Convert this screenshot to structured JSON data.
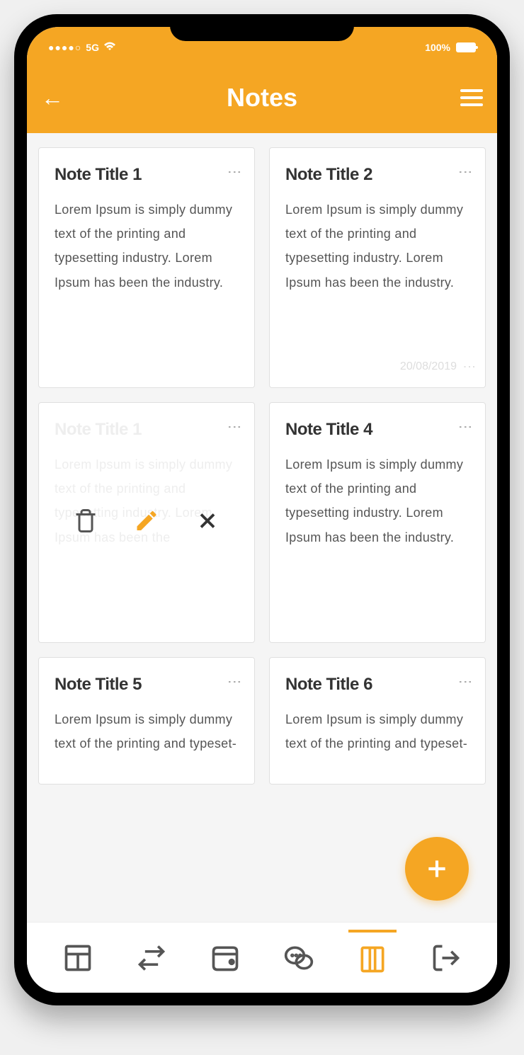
{
  "status": {
    "signal": "●●●●○",
    "network": "5G",
    "battery": "100%"
  },
  "header": {
    "title": "Notes"
  },
  "notes": [
    {
      "title": "Note Title 1",
      "body": "Lorem Ipsum is simply dummy text of the printing and typesetting industry. Lorem Ipsum has been the industry."
    },
    {
      "title": "Note Title 2",
      "body": "Lorem Ipsum is simply dummy text of the printing and typesetting industry. Lorem Ipsum has been the industry.",
      "date": "20/08/2019"
    },
    {
      "title": "Note Title 1",
      "body": "Lorem Ipsum is simply dummy text of the printing and typesetting industry. Lorem Ipsum has been the",
      "faded": true
    },
    {
      "title": "Note Title 4",
      "body": "Lorem Ipsum is simply dummy text of the printing and typesetting industry. Lorem Ipsum has been the industry."
    },
    {
      "title": "Note Title 5",
      "body": "Lorem Ipsum is simply dummy text of the printing and typeset-"
    },
    {
      "title": "Note Title 6",
      "body": "Lorem Ipsum is simply dummy text of the printing and typeset-"
    }
  ],
  "colors": {
    "accent": "#f5a623"
  }
}
